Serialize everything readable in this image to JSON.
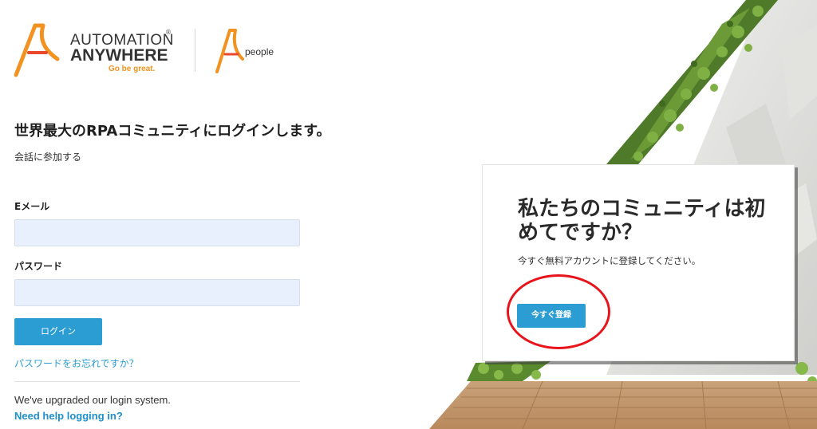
{
  "logo": {
    "brand_line1": "AUTOMATION",
    "brand_line2": "ANYWHERE",
    "registered_mark": "®",
    "tagline": "Go be great.",
    "community_word": "people",
    "brand_color": "#f29221",
    "brand_color_secondary": "#e8492a"
  },
  "login": {
    "title": "世界最大のRPAコミュニティにログインします。",
    "subtitle": "会話に参加する",
    "email_label": "Eメール",
    "email_value": "",
    "password_label": "パスワード",
    "password_value": "",
    "login_button": "ログイン",
    "forgot_link": "パスワードをお忘れですか？",
    "upgrade_note": "We've upgraded our login system.",
    "help_link": "Need help logging in?"
  },
  "signup_card": {
    "title": "私たちのコミュニティは初めてですか？",
    "text": "今すぐ無料アカウントに登録してください。",
    "button": "今すぐ登録"
  },
  "colors": {
    "accent": "#2b9dd2",
    "input_bg": "#e8f0fe",
    "highlight_circle": "#e8141b"
  },
  "icons": [
    "automation-anywhere-logo-icon",
    "people-logo-icon"
  ]
}
